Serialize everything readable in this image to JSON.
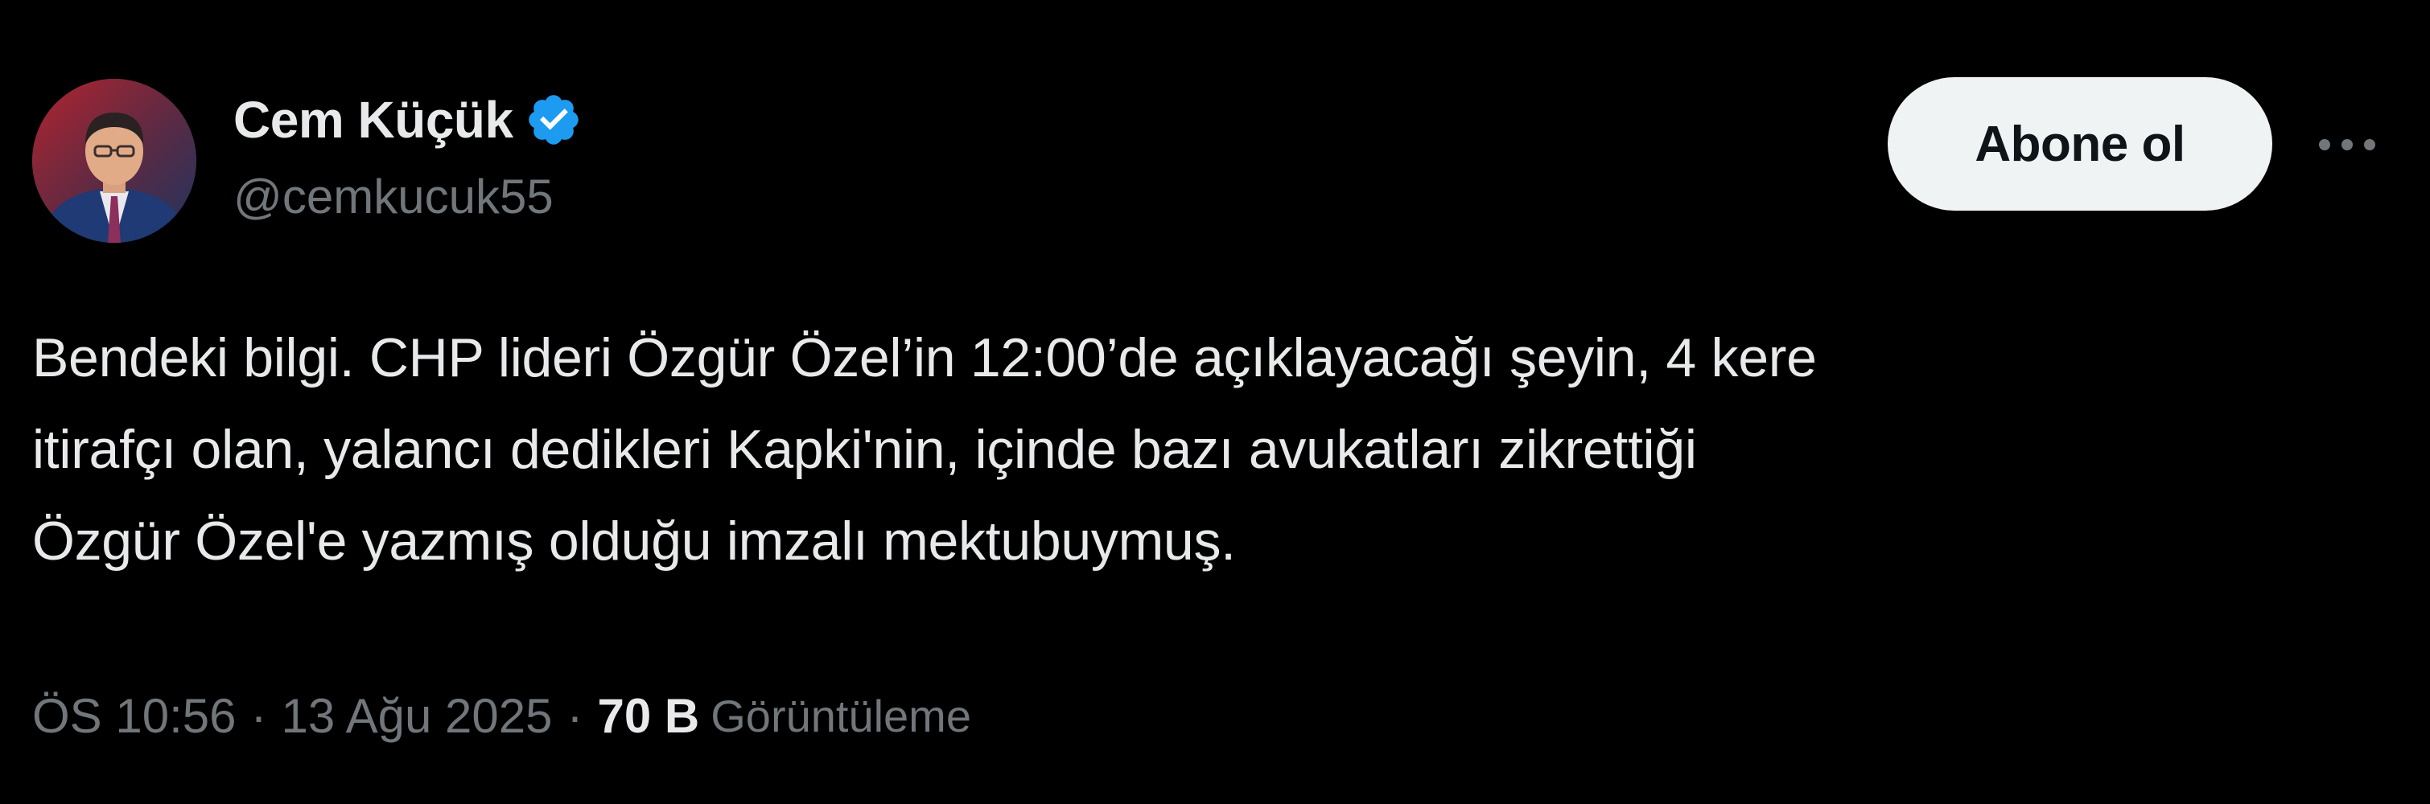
{
  "author": {
    "display_name": "Cem Küçük",
    "handle": "@cemkucuk55",
    "verified": true,
    "verified_color": "#1d9bf0"
  },
  "actions": {
    "follow_label": "Abone ol",
    "more_icon": "more-horizontal-icon"
  },
  "tweet": {
    "lines": [
      "Bendeki bilgi. CHP lideri Özgür Özel’in 12:00’de açıklayacağı şeyin, 4 kere",
      "itirafçı olan, yalancı dedikleri Kapki'nin, içinde bazı avukatları zikrettiği",
      "Özgür Özel'e yazmış olduğu imzalı mektubuymuş."
    ]
  },
  "meta": {
    "time": "ÖS 10:56",
    "separator": "·",
    "date": "13 Ağu 2025",
    "views_count": "70 B",
    "views_label": "Görüntüleme"
  },
  "colors": {
    "background": "#000000",
    "text_primary": "#e7e9ea",
    "text_secondary": "#71767b",
    "button_bg": "#eff3f4",
    "button_text": "#0f1419"
  }
}
